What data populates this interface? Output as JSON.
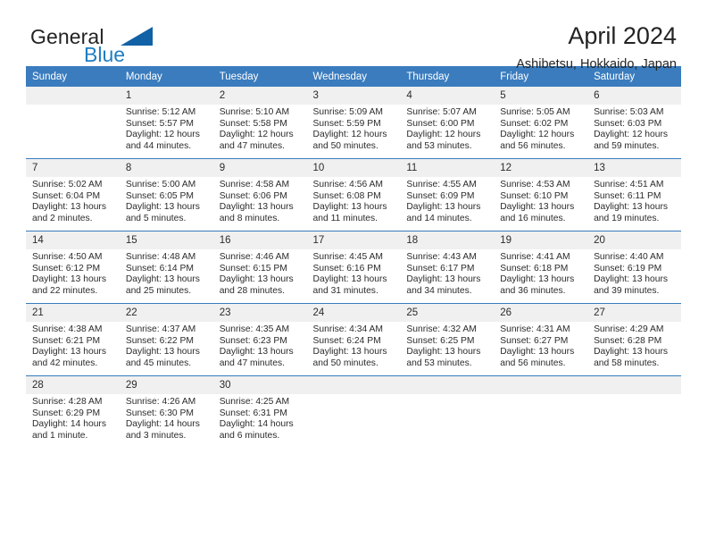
{
  "brand": {
    "name_part1": "General",
    "name_part2": "Blue",
    "flag_icon": "triangle-flag-icon",
    "accent_color": "#1161a6",
    "blue_text_color": "#1f7dc2"
  },
  "header": {
    "title": "April 2024",
    "subtitle": "Ashibetsu, Hokkaido, Japan"
  },
  "calendar": {
    "header_bg": "#3a7cbe",
    "daynum_bg": "#f0f0f0",
    "weekdays": [
      "Sunday",
      "Monday",
      "Tuesday",
      "Wednesday",
      "Thursday",
      "Friday",
      "Saturday"
    ],
    "weeks": [
      [
        {
          "day": "",
          "sunrise": "",
          "sunset": "",
          "daylight1": "",
          "daylight2": ""
        },
        {
          "day": "1",
          "sunrise": "Sunrise: 5:12 AM",
          "sunset": "Sunset: 5:57 PM",
          "daylight1": "Daylight: 12 hours",
          "daylight2": "and 44 minutes."
        },
        {
          "day": "2",
          "sunrise": "Sunrise: 5:10 AM",
          "sunset": "Sunset: 5:58 PM",
          "daylight1": "Daylight: 12 hours",
          "daylight2": "and 47 minutes."
        },
        {
          "day": "3",
          "sunrise": "Sunrise: 5:09 AM",
          "sunset": "Sunset: 5:59 PM",
          "daylight1": "Daylight: 12 hours",
          "daylight2": "and 50 minutes."
        },
        {
          "day": "4",
          "sunrise": "Sunrise: 5:07 AM",
          "sunset": "Sunset: 6:00 PM",
          "daylight1": "Daylight: 12 hours",
          "daylight2": "and 53 minutes."
        },
        {
          "day": "5",
          "sunrise": "Sunrise: 5:05 AM",
          "sunset": "Sunset: 6:02 PM",
          "daylight1": "Daylight: 12 hours",
          "daylight2": "and 56 minutes."
        },
        {
          "day": "6",
          "sunrise": "Sunrise: 5:03 AM",
          "sunset": "Sunset: 6:03 PM",
          "daylight1": "Daylight: 12 hours",
          "daylight2": "and 59 minutes."
        }
      ],
      [
        {
          "day": "7",
          "sunrise": "Sunrise: 5:02 AM",
          "sunset": "Sunset: 6:04 PM",
          "daylight1": "Daylight: 13 hours",
          "daylight2": "and 2 minutes."
        },
        {
          "day": "8",
          "sunrise": "Sunrise: 5:00 AM",
          "sunset": "Sunset: 6:05 PM",
          "daylight1": "Daylight: 13 hours",
          "daylight2": "and 5 minutes."
        },
        {
          "day": "9",
          "sunrise": "Sunrise: 4:58 AM",
          "sunset": "Sunset: 6:06 PM",
          "daylight1": "Daylight: 13 hours",
          "daylight2": "and 8 minutes."
        },
        {
          "day": "10",
          "sunrise": "Sunrise: 4:56 AM",
          "sunset": "Sunset: 6:08 PM",
          "daylight1": "Daylight: 13 hours",
          "daylight2": "and 11 minutes."
        },
        {
          "day": "11",
          "sunrise": "Sunrise: 4:55 AM",
          "sunset": "Sunset: 6:09 PM",
          "daylight1": "Daylight: 13 hours",
          "daylight2": "and 14 minutes."
        },
        {
          "day": "12",
          "sunrise": "Sunrise: 4:53 AM",
          "sunset": "Sunset: 6:10 PM",
          "daylight1": "Daylight: 13 hours",
          "daylight2": "and 16 minutes."
        },
        {
          "day": "13",
          "sunrise": "Sunrise: 4:51 AM",
          "sunset": "Sunset: 6:11 PM",
          "daylight1": "Daylight: 13 hours",
          "daylight2": "and 19 minutes."
        }
      ],
      [
        {
          "day": "14",
          "sunrise": "Sunrise: 4:50 AM",
          "sunset": "Sunset: 6:12 PM",
          "daylight1": "Daylight: 13 hours",
          "daylight2": "and 22 minutes."
        },
        {
          "day": "15",
          "sunrise": "Sunrise: 4:48 AM",
          "sunset": "Sunset: 6:14 PM",
          "daylight1": "Daylight: 13 hours",
          "daylight2": "and 25 minutes."
        },
        {
          "day": "16",
          "sunrise": "Sunrise: 4:46 AM",
          "sunset": "Sunset: 6:15 PM",
          "daylight1": "Daylight: 13 hours",
          "daylight2": "and 28 minutes."
        },
        {
          "day": "17",
          "sunrise": "Sunrise: 4:45 AM",
          "sunset": "Sunset: 6:16 PM",
          "daylight1": "Daylight: 13 hours",
          "daylight2": "and 31 minutes."
        },
        {
          "day": "18",
          "sunrise": "Sunrise: 4:43 AM",
          "sunset": "Sunset: 6:17 PM",
          "daylight1": "Daylight: 13 hours",
          "daylight2": "and 34 minutes."
        },
        {
          "day": "19",
          "sunrise": "Sunrise: 4:41 AM",
          "sunset": "Sunset: 6:18 PM",
          "daylight1": "Daylight: 13 hours",
          "daylight2": "and 36 minutes."
        },
        {
          "day": "20",
          "sunrise": "Sunrise: 4:40 AM",
          "sunset": "Sunset: 6:19 PM",
          "daylight1": "Daylight: 13 hours",
          "daylight2": "and 39 minutes."
        }
      ],
      [
        {
          "day": "21",
          "sunrise": "Sunrise: 4:38 AM",
          "sunset": "Sunset: 6:21 PM",
          "daylight1": "Daylight: 13 hours",
          "daylight2": "and 42 minutes."
        },
        {
          "day": "22",
          "sunrise": "Sunrise: 4:37 AM",
          "sunset": "Sunset: 6:22 PM",
          "daylight1": "Daylight: 13 hours",
          "daylight2": "and 45 minutes."
        },
        {
          "day": "23",
          "sunrise": "Sunrise: 4:35 AM",
          "sunset": "Sunset: 6:23 PM",
          "daylight1": "Daylight: 13 hours",
          "daylight2": "and 47 minutes."
        },
        {
          "day": "24",
          "sunrise": "Sunrise: 4:34 AM",
          "sunset": "Sunset: 6:24 PM",
          "daylight1": "Daylight: 13 hours",
          "daylight2": "and 50 minutes."
        },
        {
          "day": "25",
          "sunrise": "Sunrise: 4:32 AM",
          "sunset": "Sunset: 6:25 PM",
          "daylight1": "Daylight: 13 hours",
          "daylight2": "and 53 minutes."
        },
        {
          "day": "26",
          "sunrise": "Sunrise: 4:31 AM",
          "sunset": "Sunset: 6:27 PM",
          "daylight1": "Daylight: 13 hours",
          "daylight2": "and 56 minutes."
        },
        {
          "day": "27",
          "sunrise": "Sunrise: 4:29 AM",
          "sunset": "Sunset: 6:28 PM",
          "daylight1": "Daylight: 13 hours",
          "daylight2": "and 58 minutes."
        }
      ],
      [
        {
          "day": "28",
          "sunrise": "Sunrise: 4:28 AM",
          "sunset": "Sunset: 6:29 PM",
          "daylight1": "Daylight: 14 hours",
          "daylight2": "and 1 minute."
        },
        {
          "day": "29",
          "sunrise": "Sunrise: 4:26 AM",
          "sunset": "Sunset: 6:30 PM",
          "daylight1": "Daylight: 14 hours",
          "daylight2": "and 3 minutes."
        },
        {
          "day": "30",
          "sunrise": "Sunrise: 4:25 AM",
          "sunset": "Sunset: 6:31 PM",
          "daylight1": "Daylight: 14 hours",
          "daylight2": "and 6 minutes."
        },
        {
          "day": "",
          "sunrise": "",
          "sunset": "",
          "daylight1": "",
          "daylight2": ""
        },
        {
          "day": "",
          "sunrise": "",
          "sunset": "",
          "daylight1": "",
          "daylight2": ""
        },
        {
          "day": "",
          "sunrise": "",
          "sunset": "",
          "daylight1": "",
          "daylight2": ""
        },
        {
          "day": "",
          "sunrise": "",
          "sunset": "",
          "daylight1": "",
          "daylight2": ""
        }
      ]
    ]
  }
}
